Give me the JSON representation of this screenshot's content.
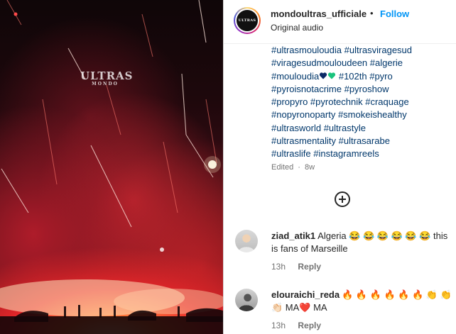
{
  "media": {
    "watermark": {
      "title": "ULTRAS",
      "subtitle": "MONDO"
    }
  },
  "header": {
    "avatar_text": "ULTRAS",
    "username": "mondoultras_ufficiale",
    "separator": "•",
    "follow_label": "Follow",
    "audio": "Original audio",
    "more": "…"
  },
  "caption": {
    "lines": [
      "#ultrasmouloudia #ultrasviragesud",
      "#viragesudmouloudeen #algerie",
      "#mouloudia",
      "#pyroisnotacrime #pyroshow",
      "#propyro #pyrotechnik #craquage",
      "#nopyronoparty #smokeishealthy",
      "#ultrasworld #ultrastyle",
      "#ultrasmentality #ultrasarabe",
      "#ultraslife #instagramreels"
    ],
    "line3_rest": "#102th #pyro",
    "heart_colors": [
      "#0b2a66",
      "#19c37d"
    ],
    "edited": "Edited",
    "edited_sep": "·",
    "age": "8w"
  },
  "comments": [
    {
      "username": "ziad_atik1",
      "text": "Algeria 😂 😂 😂 😂 😂 😂 this is fans of Marseille",
      "age": "13h",
      "reply_label": "Reply"
    },
    {
      "username": "elouraichi_reda",
      "text": "🔥 🔥 🔥 🔥 🔥 🔥 👏 👏 👏🏻 MA❤️ MA",
      "age": "13h",
      "reply_label": "Reply"
    }
  ],
  "colors": {
    "link": "#00376b",
    "follow": "#0095f6",
    "muted": "#737373"
  }
}
